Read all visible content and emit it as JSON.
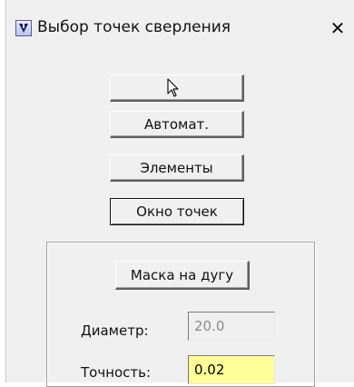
{
  "window": {
    "title": "Выбор точек сверления",
    "close_glyph": "✕"
  },
  "buttons": {
    "select": "",
    "auto": "Автомат.",
    "elements": "Элементы",
    "points_window": "Окно точек",
    "arc_mask": "Маска на дугу"
  },
  "fields": {
    "diameter_label": "Диаметр:",
    "diameter_value": "20.0",
    "accuracy_label": "Точность:",
    "accuracy_value": "0.02"
  },
  "icons": {
    "app": "drill-app-icon",
    "select": "arrow-cursor-icon"
  },
  "colors": {
    "window_bg": "#f0f0f0",
    "accuracy_field_bg": "#ffff99"
  }
}
